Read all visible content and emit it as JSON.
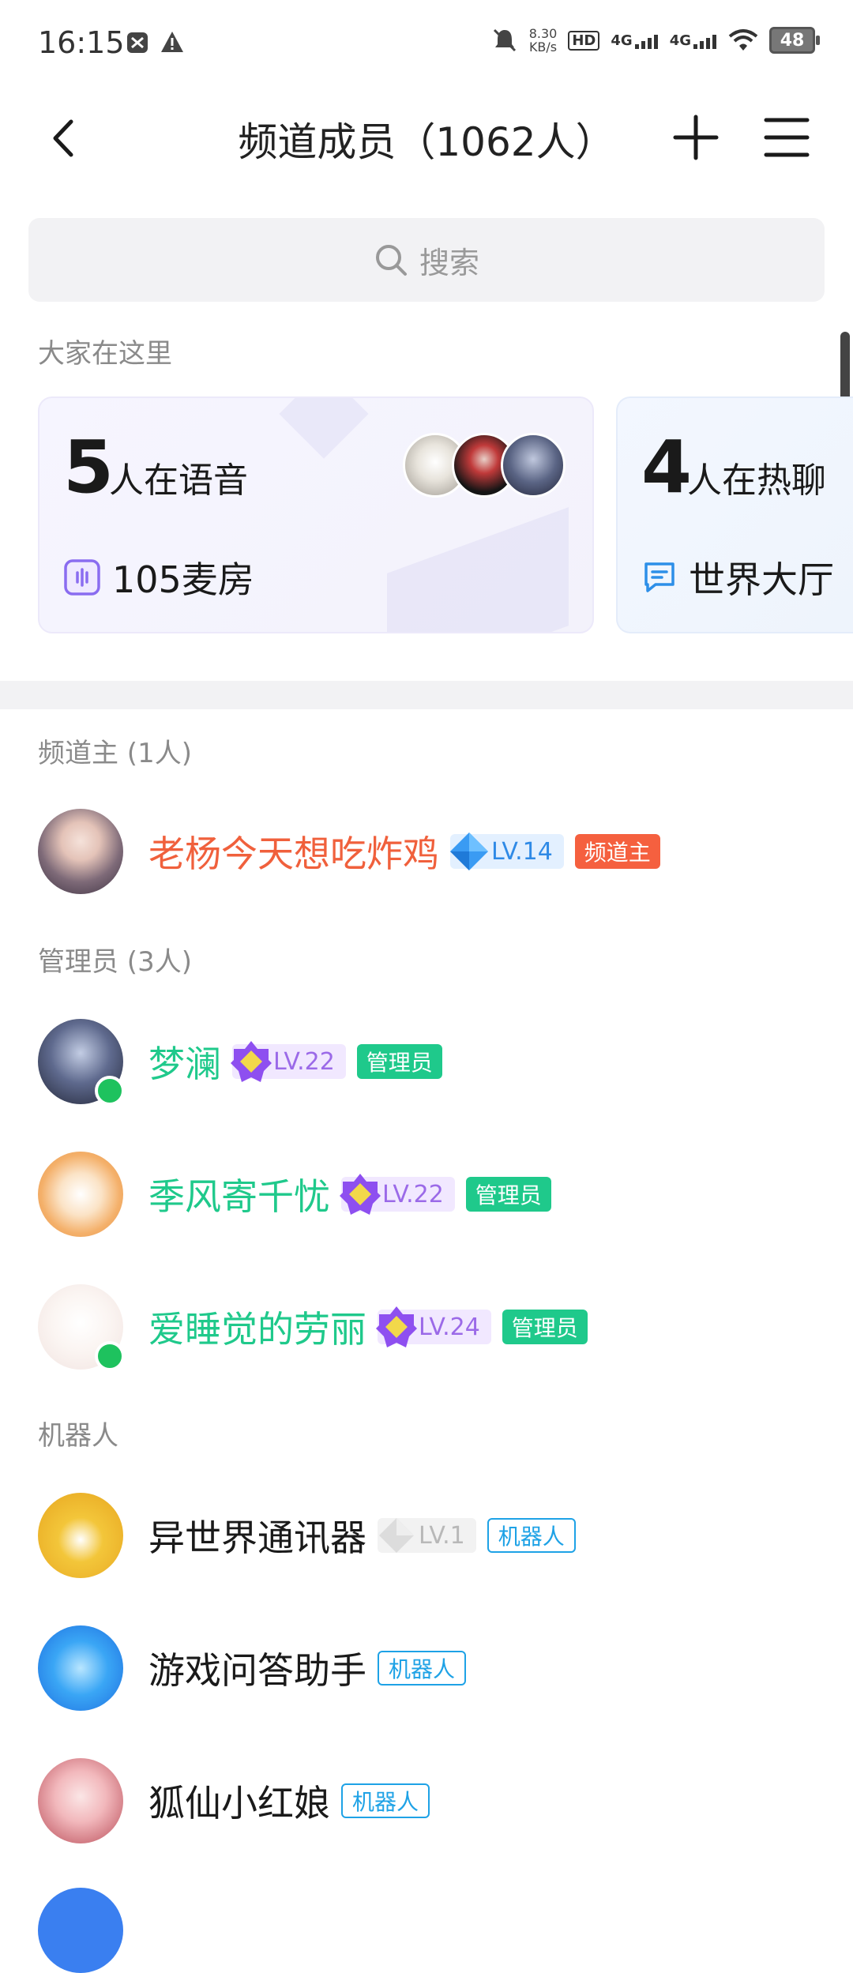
{
  "status_bar": {
    "time": "16:15",
    "net_speed_value": "8.30",
    "net_speed_unit": "KB/s",
    "hd_label": "HD",
    "signal1": "4G",
    "signal2": "4G",
    "battery": "48"
  },
  "header": {
    "title": "频道成员（1062人）"
  },
  "search": {
    "placeholder": "搜索"
  },
  "activity": {
    "section_label": "大家在这里",
    "cards": [
      {
        "count": "5",
        "unit": "人在语音",
        "room": "105麦房"
      },
      {
        "count": "4",
        "unit": "人在热聊",
        "room": "世界大厅"
      }
    ]
  },
  "owners": {
    "label": "频道主 (1人)",
    "members": [
      {
        "name": "老杨今天想吃炸鸡",
        "level": "LV.14",
        "tag": "频道主"
      }
    ]
  },
  "admins": {
    "label": "管理员 (3人)",
    "members": [
      {
        "name": "梦澜",
        "level": "LV.22",
        "tag": "管理员"
      },
      {
        "name": "季风寄千忧",
        "level": "LV.22",
        "tag": "管理员"
      },
      {
        "name": "爱睡觉的劳丽",
        "level": "LV.24",
        "tag": "管理员"
      }
    ]
  },
  "robots": {
    "label": "机器人",
    "members": [
      {
        "name": "异世界通讯器",
        "level": "LV.1",
        "tag": "机器人"
      },
      {
        "name": "游戏问答助手",
        "tag": "机器人"
      },
      {
        "name": "狐仙小红娘",
        "tag": "机器人"
      }
    ]
  },
  "colors": {
    "owner_name": "#f0603c",
    "admin_name": "#1fc98b",
    "owner_tag": "#f5603f",
    "admin_tag": "#1fc98b",
    "robot_tag": "#1ea2e6",
    "online": "#1ec25e"
  },
  "icons": [
    "back-arrow-icon",
    "plus-icon",
    "menu-icon",
    "search-icon",
    "voice-room-icon",
    "chat-bubble-icon"
  ]
}
